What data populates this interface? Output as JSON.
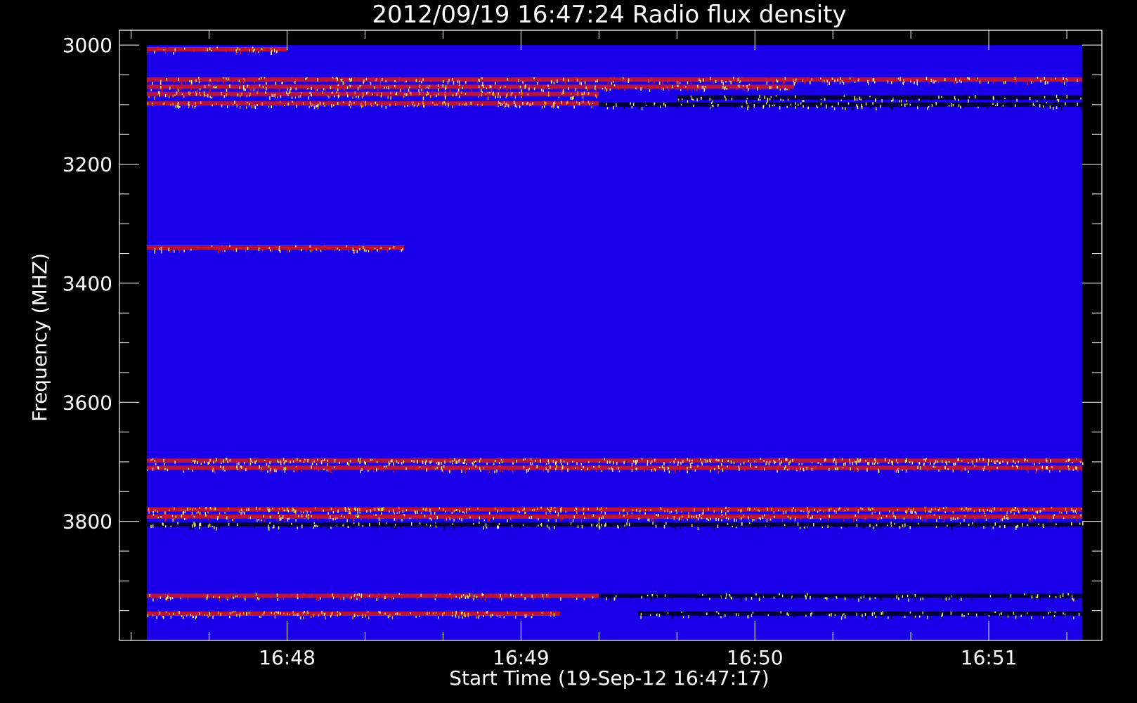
{
  "chart_data": {
    "type": "heatmap",
    "title": "2012/09/19 16:47:24 Radio flux density",
    "xlabel": "Start Time (19-Sep-12 16:47:17)",
    "ylabel": "Frequency (MHZ)",
    "x_range": [
      "16:47:17",
      "16:51:29"
    ],
    "x_data_range": [
      "16:47:24",
      "16:51:24"
    ],
    "x_ticks": [
      "16:48",
      "16:49",
      "16:50",
      "16:51"
    ],
    "y_range": [
      2975,
      4000
    ],
    "y_data_range": [
      3000,
      4000
    ],
    "y_ticks": [
      3000,
      3200,
      3400,
      3600,
      3800
    ],
    "y_reversed": true,
    "colors": {
      "background_level": "#1a00e8",
      "emission_mid": "#e11a10",
      "emission_high": "#ffa020",
      "emission_peak": "#ffff80",
      "low": "#000020"
    },
    "bands": [
      {
        "freq": 3007,
        "time_start": "16:47:24",
        "time_end": "16:48:00",
        "level": "mid"
      },
      {
        "freq": 3058,
        "time_start": "16:47:24",
        "time_end": "16:51:24",
        "level": "mid"
      },
      {
        "freq": 3070,
        "time_start": "16:47:24",
        "time_end": "16:50:10",
        "level": "mid"
      },
      {
        "freq": 3082,
        "time_start": "16:47:24",
        "time_end": "16:49:20",
        "level": "high"
      },
      {
        "freq": 3098,
        "time_start": "16:47:24",
        "time_end": "16:49:20",
        "level": "high"
      },
      {
        "freq": 3088,
        "time_start": "16:49:40",
        "time_end": "16:51:24",
        "level": "low"
      },
      {
        "freq": 3100,
        "time_start": "16:49:20",
        "time_end": "16:51:24",
        "level": "low"
      },
      {
        "freq": 3340,
        "time_start": "16:47:24",
        "time_end": "16:48:30",
        "level": "mid"
      },
      {
        "freq": 3698,
        "time_start": "16:47:24",
        "time_end": "16:51:24",
        "level": "peak"
      },
      {
        "freq": 3710,
        "time_start": "16:47:24",
        "time_end": "16:51:24",
        "level": "mid"
      },
      {
        "freq": 3780,
        "time_start": "16:47:24",
        "time_end": "16:51:24",
        "level": "high"
      },
      {
        "freq": 3792,
        "time_start": "16:47:24",
        "time_end": "16:51:24",
        "level": "mid"
      },
      {
        "freq": 3805,
        "time_start": "16:47:24",
        "time_end": "16:51:24",
        "level": "low"
      },
      {
        "freq": 3925,
        "time_start": "16:47:24",
        "time_end": "16:49:20",
        "level": "mid"
      },
      {
        "freq": 3925,
        "time_start": "16:49:20",
        "time_end": "16:51:24",
        "level": "low"
      },
      {
        "freq": 3955,
        "time_start": "16:47:24",
        "time_end": "16:49:10",
        "level": "high"
      },
      {
        "freq": 3955,
        "time_start": "16:49:30",
        "time_end": "16:51:24",
        "level": "low"
      }
    ]
  }
}
